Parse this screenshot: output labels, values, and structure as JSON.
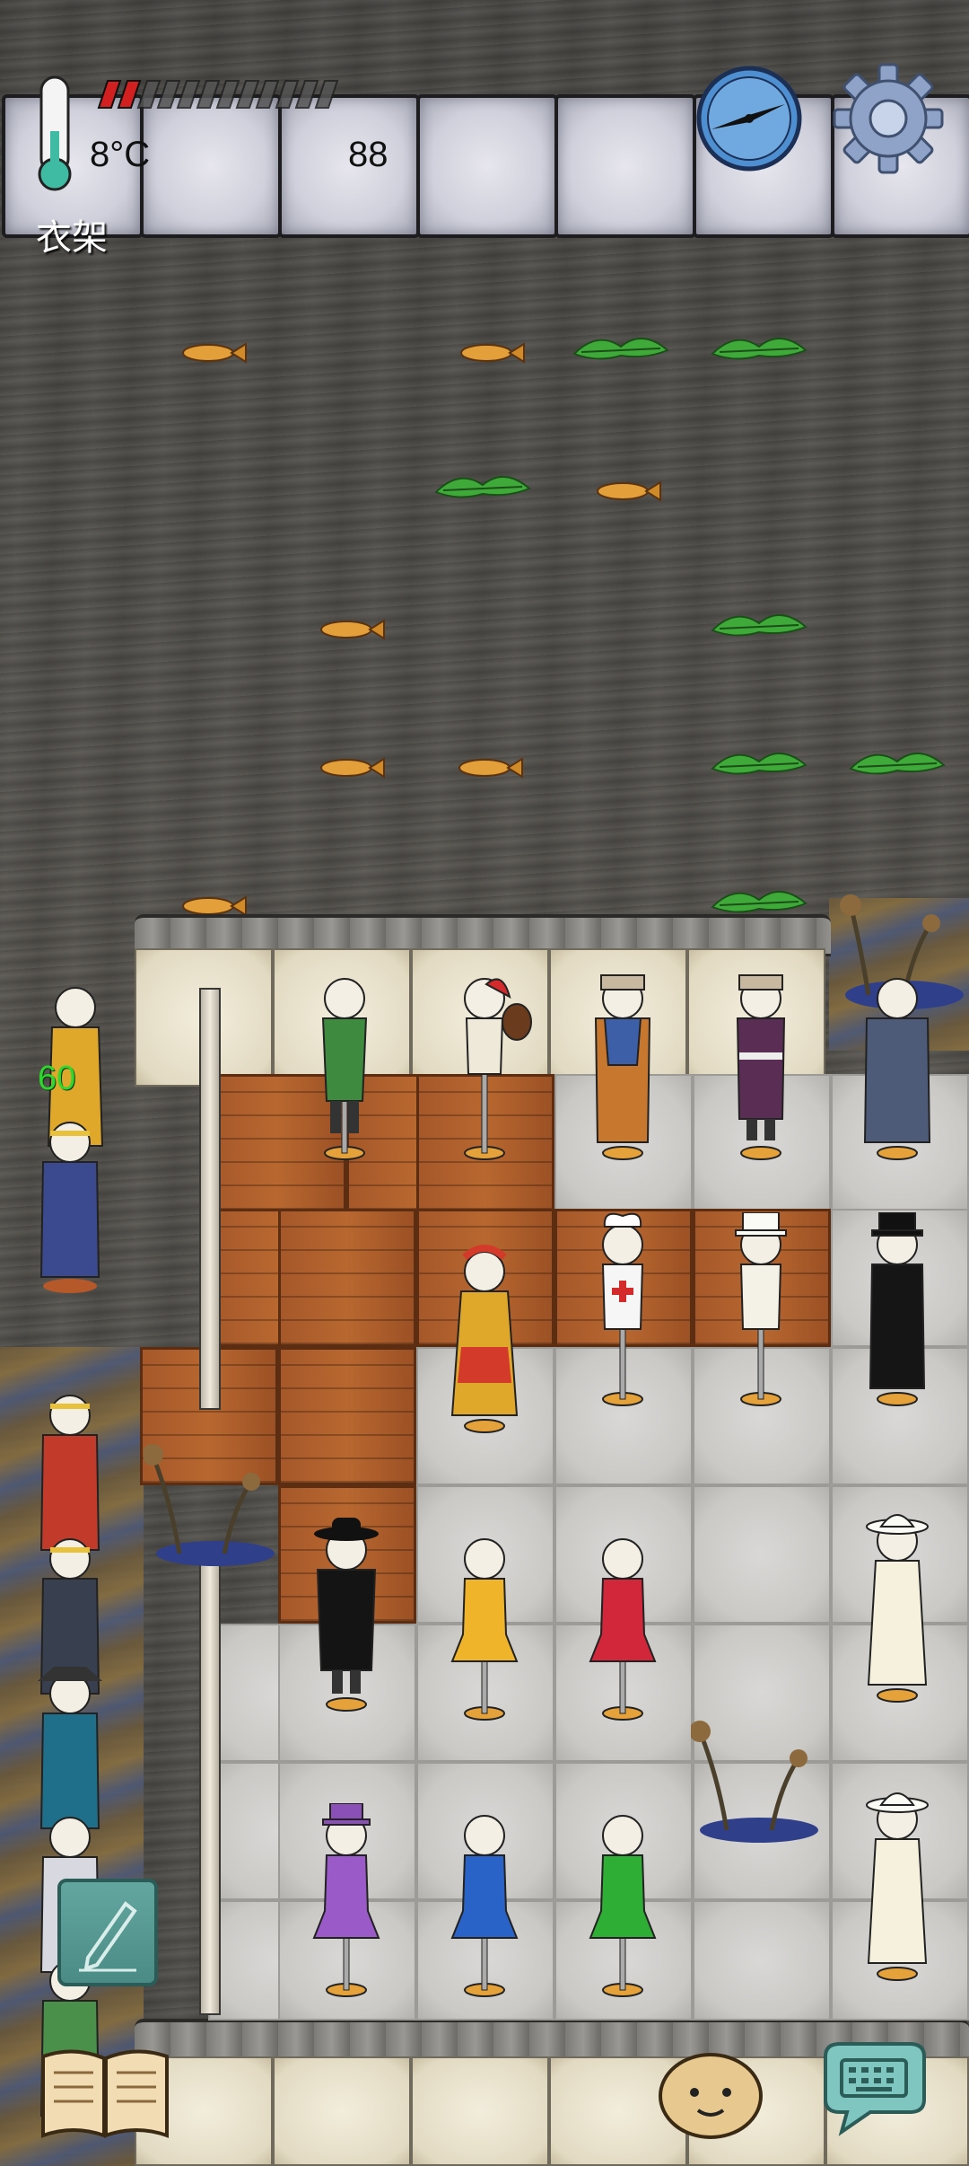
{
  "hud": {
    "temperature": "8°C",
    "food_value": "88",
    "hover_label": "衣架",
    "food_bar": {
      "filled_pips": 2,
      "total_pips": 12
    },
    "slots_count": 7
  },
  "player": {
    "age_label": "60"
  },
  "icons": {
    "thermometer": "thermometer-icon",
    "compass": "compass-icon",
    "settings": "gear-icon",
    "pencil": "pencil-icon",
    "book": "book-icon",
    "emote": "emote-icon",
    "keyboard": "keyboard-icon"
  },
  "colors": {
    "mud": "#4c4a46",
    "stone_tile": "#cfcecb",
    "wood_floor": "#b2632e",
    "food_pip_filled": "#d21f1f",
    "age_text": "#2fd82f",
    "hud_slot": "#d6d6e0"
  }
}
